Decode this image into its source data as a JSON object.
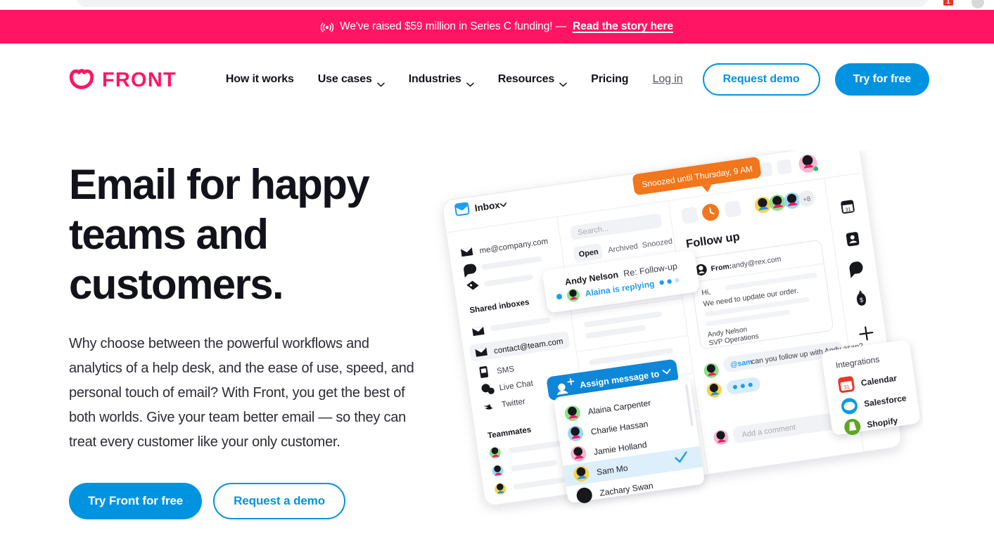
{
  "browser": {
    "extension_badge": "1"
  },
  "announcement": {
    "icon": "broadcast-icon",
    "text": "We've raised $59 million in Series C funding! —",
    "link_label": "Read the story here",
    "background": "#FF1564"
  },
  "brand": {
    "name": "FRONT",
    "logo_icon": "front-heart-logo-icon",
    "pink": "#FF1564",
    "blue": "#0093E0"
  },
  "nav": {
    "links": [
      {
        "label": "How it works",
        "has_caret": false
      },
      {
        "label": "Use cases",
        "has_caret": true
      },
      {
        "label": "Industries",
        "has_caret": true
      },
      {
        "label": "Resources",
        "has_caret": true
      },
      {
        "label": "Pricing",
        "has_caret": false
      }
    ],
    "login_label": "Log in",
    "request_demo_label": "Request demo",
    "try_free_label": "Try for free"
  },
  "hero": {
    "title": "Email for happy teams and customers.",
    "subtitle": "Why choose between the powerful workflows and analytics of a help desk, and the ease of use, speed, and personal touch of email? With Front, you get the best of both worlds. Give your team better email — so they can treat every customer like your only customer.",
    "primary_cta": "Try Front for free",
    "secondary_cta": "Request a demo"
  },
  "product_art": {
    "inbox_label": "Inbox",
    "personal_inbox": "me@company.com",
    "shared_inboxes_heading": "Shared inboxes",
    "shared_inbox_email": "contact@team.com",
    "channels": [
      "SMS",
      "Live Chat",
      "Twitter"
    ],
    "teammates_heading": "Teammates",
    "search_placeholder": "Search...",
    "list_tabs": [
      "Open",
      "Archived",
      "Snoozed"
    ],
    "active_list_tab": "Open",
    "notification_card": {
      "sender": "Andy Nelson",
      "subject": "Re: Follow-up",
      "status": "Alaina is replying"
    },
    "snooze_badge": "Snoozed until Thursday, 9 AM",
    "conversation": {
      "title": "Follow up",
      "from_label": "From:",
      "from_email": "andy@rex.com",
      "body_greeting": "Hi,",
      "body_line": "We need to update our order.",
      "signature_name": "Andy Nelson",
      "signature_title": "SVP Operations"
    },
    "comment_mention": "@sam",
    "comment_text": "can you follow up with Andy asap?",
    "comment_placeholder": "Add a comment",
    "participants_overflow": "+8",
    "assign_dropdown": {
      "label": "Assign message to",
      "options": [
        {
          "name": "Alaina Carpenter",
          "selected": false
        },
        {
          "name": "Charlie Hassan",
          "selected": false
        },
        {
          "name": "Jamie Holland",
          "selected": false
        },
        {
          "name": "Sam Mo",
          "selected": true
        },
        {
          "name": "Zachary Swan",
          "selected": false
        }
      ]
    },
    "integrations": {
      "heading": "Integrations",
      "items": [
        "Calendar",
        "Salesforce",
        "Shopify"
      ]
    }
  }
}
